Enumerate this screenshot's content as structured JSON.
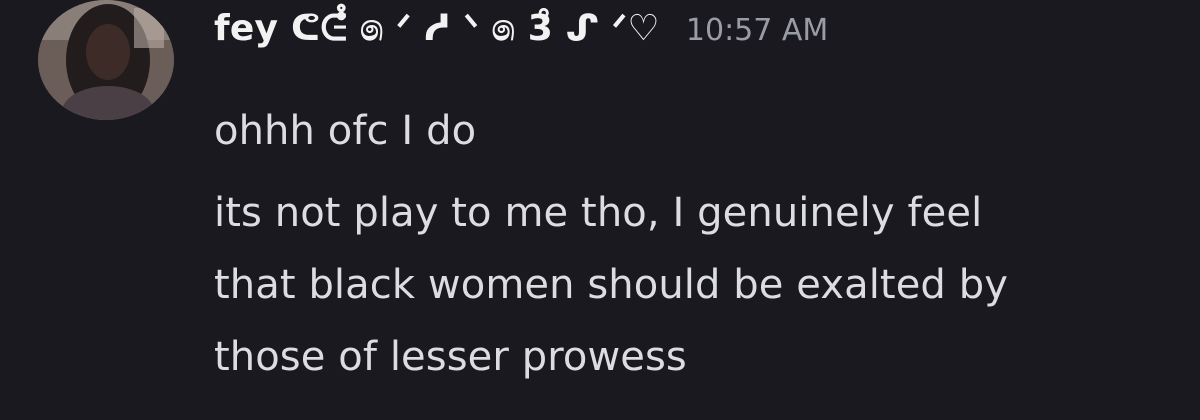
{
  "message": {
    "username": "fey ᕦᕮ̊̊ ෧ ᐟ ᓱ ᐠ ෧ 3̊̊ ᔑ ᐟ♡",
    "timestamp": "10:57 AM",
    "lines": [
      "ohhh ofc I do",
      "its not play to me tho, I genuinely feel",
      "that black women should be exalted by",
      "those of lesser prowess"
    ]
  }
}
